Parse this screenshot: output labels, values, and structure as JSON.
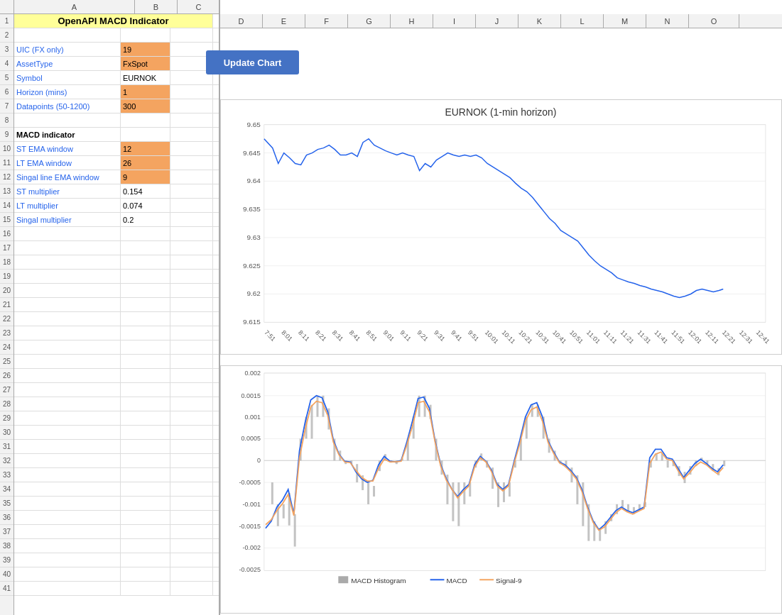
{
  "title": "OpenAPI MACD Indicator",
  "button": {
    "label": "Update Chart"
  },
  "fields": [
    {
      "label": "UIC (FX only)",
      "value": "19",
      "orange": true
    },
    {
      "label": "AssetType",
      "value": "FxSpot",
      "orange": true
    },
    {
      "label": "Symbol",
      "value": "EURNOK",
      "orange": false
    },
    {
      "label": "Horizon (mins)",
      "value": "1",
      "orange": true
    },
    {
      "label": "Datapoints (50-1200)",
      "value": "300",
      "orange": true
    }
  ],
  "macd_section": "MACD indicator",
  "macd_fields": [
    {
      "label": "ST EMA window",
      "value": "12",
      "orange": true
    },
    {
      "label": "LT EMA window",
      "value": "26",
      "orange": true
    },
    {
      "label": "Singal line EMA window",
      "value": "9",
      "orange": true
    },
    {
      "label": "ST multiplier",
      "value": "0.154",
      "orange": false
    },
    {
      "label": "LT multiplier",
      "value": "0.074",
      "orange": false
    },
    {
      "label": "Singal multiplier",
      "value": "0.2",
      "orange": false
    }
  ],
  "chart": {
    "title": "EURNOK (1-min horizon)",
    "price_yaxis": [
      "9.65",
      "9.645",
      "9.64",
      "9.635",
      "9.63",
      "9.625",
      "9.62",
      "9.615"
    ],
    "macd_yaxis": [
      "0.002",
      "0.0015",
      "0.001",
      "0.0005",
      "0",
      "-0.0005",
      "-0.001",
      "-0.0015",
      "-0.002",
      "-0.0025"
    ],
    "xaxis_labels": [
      "7:51",
      "8:01",
      "8:11",
      "8:21",
      "8:31",
      "8:41",
      "8:51",
      "9:01",
      "9:11",
      "9:21",
      "9:31",
      "9:41",
      "9:51",
      "10:01",
      "10:11",
      "10:21",
      "10:31",
      "10:41",
      "10:51",
      "11:01",
      "11:11",
      "11:21",
      "11:31",
      "11:41",
      "11:51",
      "12:01",
      "12:11",
      "12:21",
      "12:31",
      "12:41"
    ],
    "legend": [
      {
        "type": "bar",
        "label": "MACD Histogram",
        "color": "#aaa"
      },
      {
        "type": "line",
        "label": "MACD",
        "color": "#2563eb"
      },
      {
        "type": "line",
        "label": "Signal-9",
        "color": "#f4a460"
      }
    ]
  },
  "row_count": 41,
  "col_headers": [
    "",
    "A",
    "B",
    "C",
    "D",
    "E",
    "F",
    "G",
    "H",
    "I",
    "J",
    "K",
    "L",
    "M",
    "N",
    "O"
  ]
}
